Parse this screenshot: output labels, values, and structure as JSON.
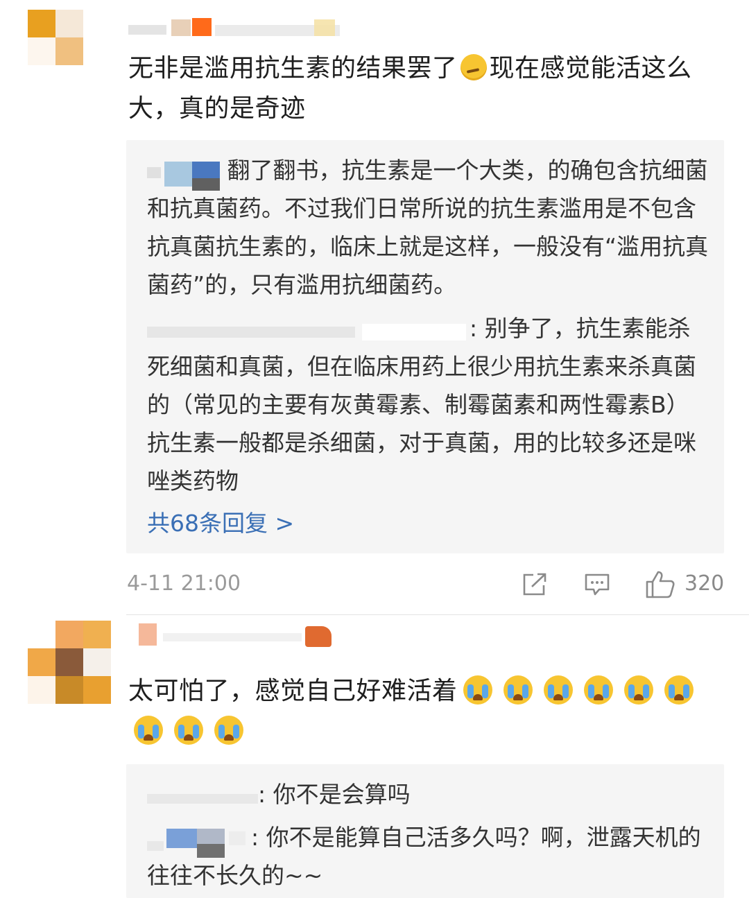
{
  "comments": [
    {
      "text_part1": "无非是滥用抗生素的结果罢了",
      "emoji": "smirk-face",
      "text_part2": "现在感觉能活这么大，真的是奇迹",
      "replies": [
        {
          "text": "翻了翻书，抗生素是一个大类，的确包含抗细菌和抗真菌药。不过我们日常所说的抗生素滥用是不包含抗真菌抗生素的，临床上就是这样，一般没有“滥用抗真菌药”的，只有滥用抗细菌药。"
        },
        {
          "text": ": 别争了，抗生素能杀死细菌和真菌，但在临床用药上很少用抗生素来杀真菌的（常见的主要有灰黄霉素、制霉菌素和两性霉素B）抗生素一般都是杀细菌，对于真菌，用的比较多还是咪唑类药物"
        }
      ],
      "more_replies": "共68条回复 >",
      "time": "4-11 21:00",
      "likes": "320"
    },
    {
      "text": "太可怕了，感觉自己好难活着",
      "emoji": "crying-face",
      "emoji_count": 9,
      "replies": [
        {
          "text": ": 你不是会算吗"
        },
        {
          "text": ": 你不是能算自己活多久吗？啊，泄露天机的往往不长久的~~"
        }
      ]
    }
  ],
  "colors": {
    "link": "#3a6fb5",
    "reply_bg": "#f5f5f5",
    "meta": "#9a9a9a"
  },
  "icons": [
    "share-icon",
    "comment-icon",
    "like-thumb-icon"
  ]
}
